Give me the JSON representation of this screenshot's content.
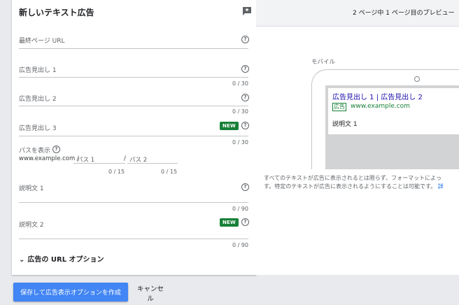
{
  "form": {
    "title": "新しいテキスト広告",
    "final_url_label": "最終ページ URL",
    "headline1_label": "広告見出し 1",
    "headline1_counter": "0 / 30",
    "headline2_label": "広告見出し 2",
    "headline2_counter": "0 / 30",
    "headline3_label": "広告見出し 3",
    "headline3_counter": "0 / 30",
    "new_badge": "NEW",
    "path_label": "パスを表示",
    "path_domain": "www.example.com /",
    "path1_placeholder": "パス 1",
    "path1_counter": "0 / 15",
    "path2_sep": "/",
    "path2_placeholder": "パス 2",
    "path2_counter": "0 / 15",
    "desc1_label": "説明文 1",
    "desc1_counter": "0 / 90",
    "desc2_label": "説明文 2",
    "desc2_counter": "0 / 90",
    "url_options": "広告の URL オプション"
  },
  "preview": {
    "header": "2 ページ中 1 ページ目のプレビュー",
    "mobile_label": "モバイル",
    "ad_headline": "広告見出し 1 | 広告見出し 2",
    "ad_badge": "広告",
    "ad_url": "www.example.com",
    "ad_description": "説明文 1",
    "disclaimer_line1": "すべてのテキストが広告に表示されるとは限らず、フォーマットによっ",
    "disclaimer_line2": "す。特定のテキストが広告に表示されるようにすることは可能です。",
    "disclaimer_link": "詳"
  },
  "actions": {
    "save_label": "保存して広告表示オプションを作成",
    "cancel_label": "キャンセル"
  },
  "colors": {
    "primary": "#4285f4",
    "new_badge": "#188038",
    "ad_headline": "#1a0dab",
    "ad_url": "#188038"
  }
}
